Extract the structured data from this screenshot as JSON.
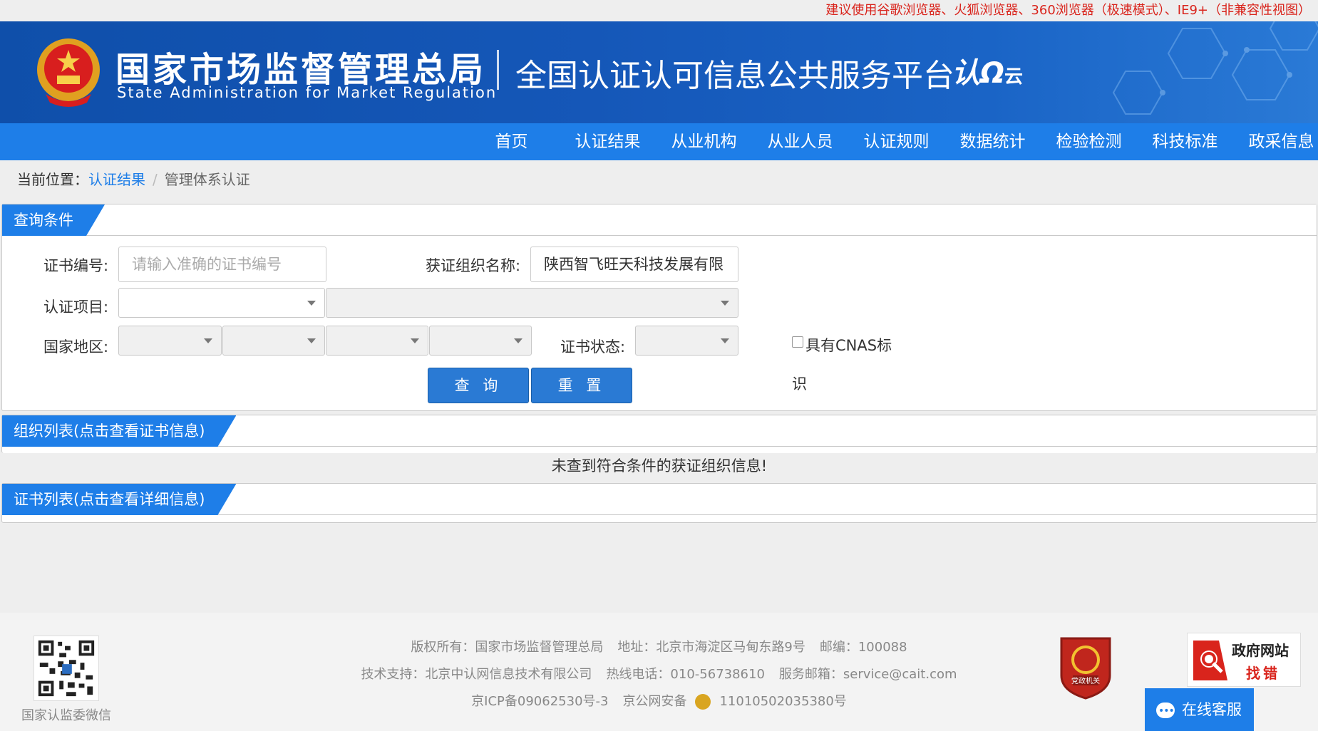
{
  "notice": "建议使用谷歌浏览器、火狐浏览器、360浏览器（极速模式）、IE9+（非兼容性视图）",
  "header": {
    "org_cn": "国家市场监督管理总局",
    "org_en": "State Administration  for  Market Regulation",
    "platform": "全国认证认可信息公共服务平台",
    "logo_main": "认",
    "logo_sub": "云"
  },
  "nav": [
    "首页",
    "认证结果",
    "从业机构",
    "从业人员",
    "认证规则",
    "数据统计",
    "检验检测",
    "科技标准",
    "政采信息"
  ],
  "breadcrumb": {
    "prefix": "当前位置：",
    "link": "认证结果",
    "sep": "/",
    "current": "管理体系认证"
  },
  "query": {
    "title": "查询条件",
    "cert_no_label": "证书编号:",
    "cert_no_placeholder": "请输入准确的证书编号",
    "org_name_label": "获证组织名称:",
    "org_name_value": "陕西智飞旺天科技发展有限",
    "project_label": "认证项目:",
    "region_label": "国家地区:",
    "status_label": "证书状态:",
    "cnas_label_1": "具有CNAS标",
    "cnas_label_2": "识",
    "search_btn": "查 询",
    "reset_btn": "重 置"
  },
  "org_list": {
    "title": "组织列表(点击查看证书信息)",
    "empty": "未查到符合条件的获证组织信息!"
  },
  "cert_list": {
    "title": "证书列表(点击查看详细信息)"
  },
  "footer": {
    "qr_caption": "国家认监委微信",
    "line1": [
      "版权所有：国家市场监督管理总局",
      "地址：北京市海淀区马甸东路9号",
      "邮编：100088"
    ],
    "line2": [
      "技术支持：北京中认网信息技术有限公司",
      "热线电话：010-56738610",
      "服务邮箱：service@cait.com"
    ],
    "icp": "京ICP备09062530号-3",
    "police_prefix": "京公网安备",
    "police_no": "11010502035380号",
    "party_badge": "党政机关",
    "gov_t1": "政府网站",
    "gov_t2": "找错",
    "service": "在线客服"
  }
}
